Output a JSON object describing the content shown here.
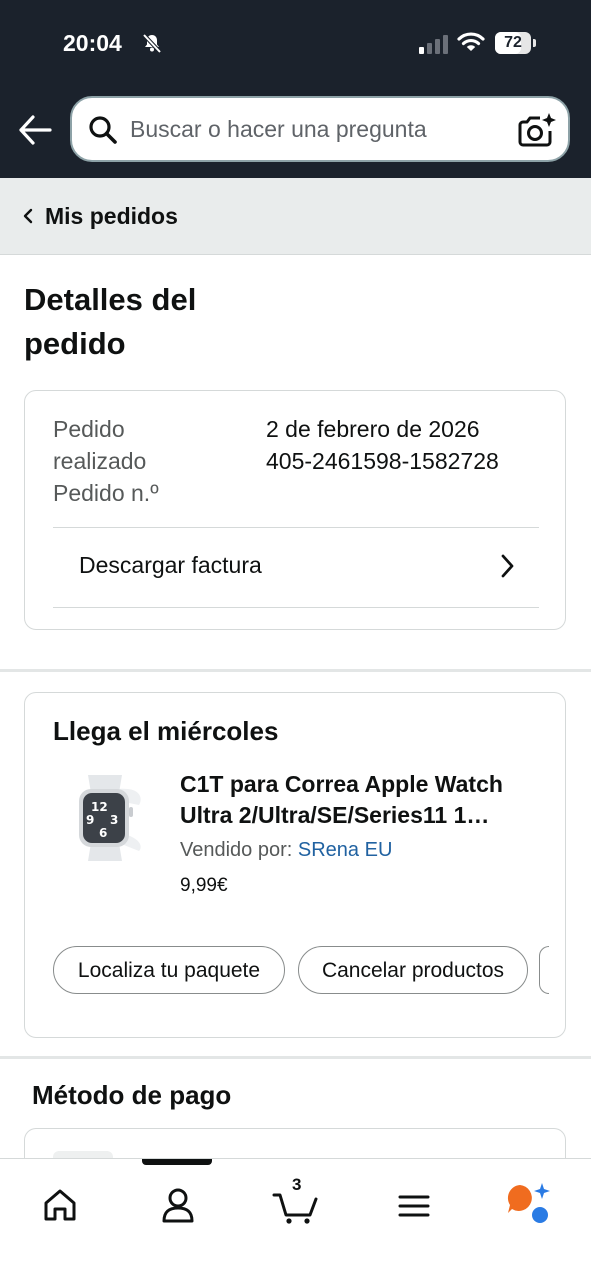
{
  "status_bar": {
    "time": "20:04",
    "battery": "72",
    "battery_level": 0.72
  },
  "search": {
    "placeholder": "Buscar o hacer una pregunta"
  },
  "breadcrumb": {
    "label": "Mis pedidos"
  },
  "page": {
    "title": "Detalles del pedido"
  },
  "order": {
    "placed_label": "Pedido realizado",
    "placed_value": "2 de febrero de 2026",
    "number_label": "Pedido n.º",
    "number_value": "405-2461598-1582728",
    "invoice_label": "Descargar factura"
  },
  "delivery": {
    "heading": "Llega el miércoles",
    "product_title_line1": "C1T para Correa Apple Watch",
    "product_title_line2": "Ultra 2/Ultra/SE/Series11 1…",
    "sold_by_label": "Vendido por:",
    "seller": "SRena EU",
    "price": "9,99€",
    "actions": [
      {
        "label": "Localiza tu paquete"
      },
      {
        "label": "Cancelar productos"
      }
    ]
  },
  "payment": {
    "heading": "Método de pago"
  },
  "bottom_nav": {
    "items": [
      {
        "icon": "home-icon"
      },
      {
        "icon": "account-icon"
      },
      {
        "icon": "cart-icon",
        "count": "3"
      },
      {
        "icon": "menu-icon"
      },
      {
        "icon": "rufus-icon"
      }
    ]
  },
  "colors": {
    "header_bg": "#1b222c",
    "link": "#2162a1",
    "breadcrumb_bg": "#e9ecec",
    "rufus_orange": "#f06c1f",
    "rufus_blue": "#2a7be4"
  }
}
